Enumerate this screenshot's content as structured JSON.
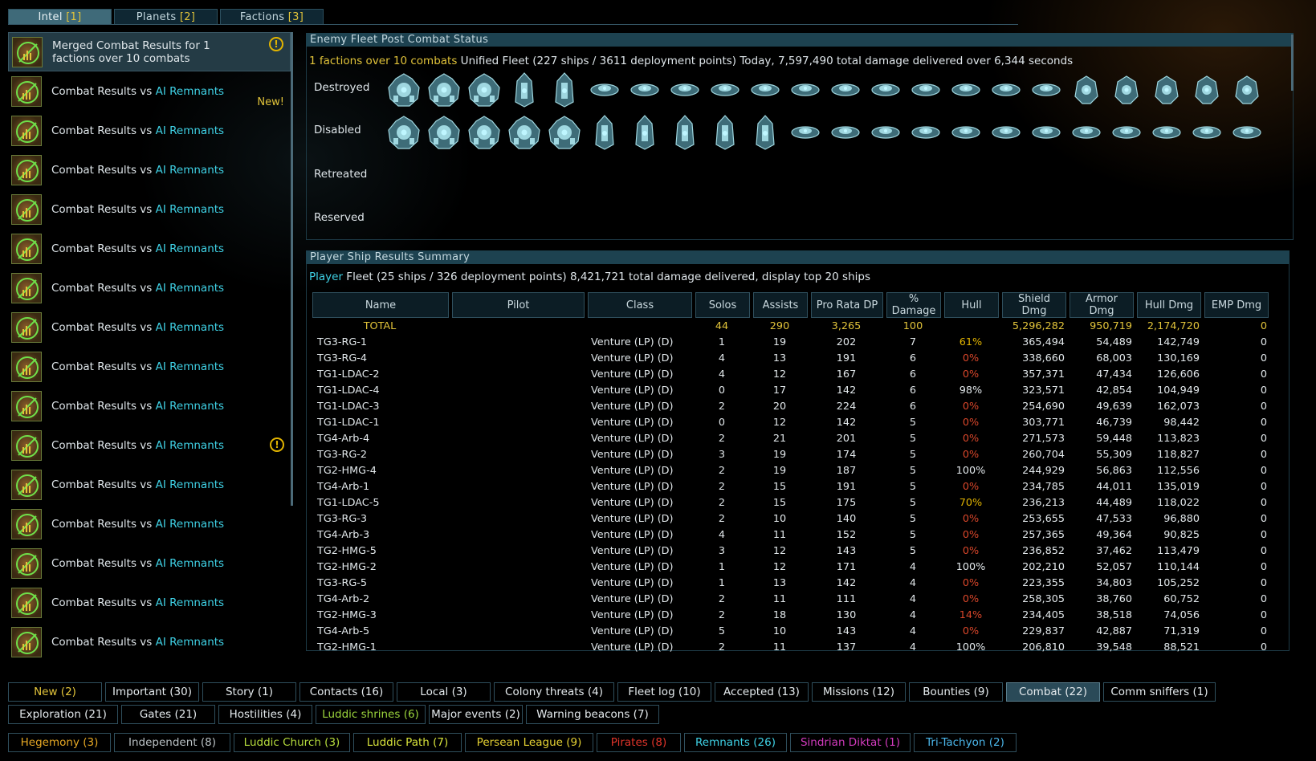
{
  "top_tabs": [
    {
      "label": "Intel",
      "count": "[1]",
      "active": true
    },
    {
      "label": "Planets",
      "count": "[2]",
      "active": false
    },
    {
      "label": "Factions",
      "count": "[3]",
      "active": false
    }
  ],
  "intel_list": {
    "merged": {
      "title": "Merged Combat Results for 1 factions over 10 combats"
    },
    "item_prefix": "Combat Results vs ",
    "item_faction": "AI Remnants",
    "new_label": "New!",
    "warn_glyph": "!",
    "item_count": 15
  },
  "enemy_panel": {
    "title": "Enemy Fleet Post Combat Status",
    "summary_highlight": "1 factions over 10 combats",
    "summary_rest": " Unified Fleet (227 ships / 3611 deployment points) Today, 7,597,490 total damage delivered over 6,344 seconds",
    "rows": [
      {
        "label": "Destroyed",
        "ships": [
          "heavy",
          "heavy",
          "heavy",
          "tower",
          "tower",
          "disc",
          "disc",
          "disc",
          "disc",
          "disc",
          "disc",
          "disc",
          "disc",
          "disc",
          "disc",
          "disc",
          "disc",
          "claw",
          "claw",
          "claw",
          "claw",
          "claw"
        ]
      },
      {
        "label": "Disabled",
        "ships": [
          "heavy",
          "heavy",
          "heavy",
          "heavy",
          "heavy",
          "tower",
          "tower",
          "tower",
          "tower",
          "tower",
          "disc",
          "disc",
          "disc",
          "disc",
          "disc",
          "disc",
          "disc",
          "disc",
          "disc",
          "disc",
          "disc",
          "disc"
        ]
      },
      {
        "label": "Retreated",
        "ships": []
      },
      {
        "label": "Reserved",
        "ships": []
      }
    ]
  },
  "player_panel": {
    "title": "Player Ship Results Summary",
    "summary_highlight": "Player",
    "summary_rest": " Fleet (25 ships / 326 deployment points) 8,421,721 total damage delivered, display top 20 ships",
    "columns": [
      "Name",
      "Pilot",
      "Class",
      "Solos",
      "Assists",
      "Pro Rata DP",
      "% Damage",
      "Hull",
      "Shield Dmg",
      "Armor Dmg",
      "Hull Dmg",
      "EMP Dmg"
    ],
    "total": {
      "name": "TOTAL",
      "solos": "44",
      "assists": "290",
      "dp": "3,265",
      "dmg": "100",
      "hull": "",
      "shield": "5,296,282",
      "armor": "950,719",
      "hulldmg": "2,174,720",
      "emp": "0"
    },
    "rows": [
      {
        "name": "TG3-RG-1",
        "cls": "Venture (LP) (D)",
        "solos": "1",
        "assists": "19",
        "dp": "202",
        "dmg": "7",
        "hull": "61%",
        "hc": "yel",
        "shield": "365,494",
        "armor": "54,489",
        "hulldmg": "142,749",
        "emp": "0"
      },
      {
        "name": "TG3-RG-4",
        "cls": "Venture (LP) (D)",
        "solos": "4",
        "assists": "13",
        "dp": "191",
        "dmg": "6",
        "hull": "0%",
        "hc": "red",
        "shield": "338,660",
        "armor": "68,003",
        "hulldmg": "130,169",
        "emp": "0"
      },
      {
        "name": "TG1-LDAC-2",
        "cls": "Venture (LP) (D)",
        "solos": "4",
        "assists": "12",
        "dp": "167",
        "dmg": "6",
        "hull": "0%",
        "hc": "red",
        "shield": "357,371",
        "armor": "47,434",
        "hulldmg": "126,606",
        "emp": "0"
      },
      {
        "name": "TG1-LDAC-4",
        "cls": "Venture (LP) (D)",
        "solos": "0",
        "assists": "17",
        "dp": "142",
        "dmg": "6",
        "hull": "98%",
        "hc": "",
        "shield": "323,571",
        "armor": "42,854",
        "hulldmg": "104,949",
        "emp": "0"
      },
      {
        "name": "TG1-LDAC-3",
        "cls": "Venture (LP) (D)",
        "solos": "2",
        "assists": "20",
        "dp": "224",
        "dmg": "6",
        "hull": "0%",
        "hc": "red",
        "shield": "254,690",
        "armor": "49,639",
        "hulldmg": "162,073",
        "emp": "0"
      },
      {
        "name": "TG1-LDAC-1",
        "cls": "Venture (LP) (D)",
        "solos": "0",
        "assists": "12",
        "dp": "142",
        "dmg": "5",
        "hull": "0%",
        "hc": "red",
        "shield": "303,771",
        "armor": "46,739",
        "hulldmg": "98,442",
        "emp": "0"
      },
      {
        "name": "TG4-Arb-4",
        "cls": "Venture (LP) (D)",
        "solos": "2",
        "assists": "21",
        "dp": "201",
        "dmg": "5",
        "hull": "0%",
        "hc": "red",
        "shield": "271,573",
        "armor": "59,448",
        "hulldmg": "113,823",
        "emp": "0"
      },
      {
        "name": "TG3-RG-2",
        "cls": "Venture (LP) (D)",
        "solos": "3",
        "assists": "19",
        "dp": "174",
        "dmg": "5",
        "hull": "0%",
        "hc": "red",
        "shield": "260,704",
        "armor": "55,309",
        "hulldmg": "118,827",
        "emp": "0"
      },
      {
        "name": "TG2-HMG-4",
        "cls": "Venture (LP) (D)",
        "solos": "2",
        "assists": "19",
        "dp": "187",
        "dmg": "5",
        "hull": "100%",
        "hc": "",
        "shield": "244,929",
        "armor": "56,863",
        "hulldmg": "112,556",
        "emp": "0"
      },
      {
        "name": "TG4-Arb-1",
        "cls": "Venture (LP) (D)",
        "solos": "2",
        "assists": "15",
        "dp": "191",
        "dmg": "5",
        "hull": "0%",
        "hc": "red",
        "shield": "234,785",
        "armor": "44,011",
        "hulldmg": "135,019",
        "emp": "0"
      },
      {
        "name": "TG1-LDAC-5",
        "cls": "Venture (LP) (D)",
        "solos": "2",
        "assists": "15",
        "dp": "175",
        "dmg": "5",
        "hull": "70%",
        "hc": "yel",
        "shield": "236,213",
        "armor": "44,489",
        "hulldmg": "118,022",
        "emp": "0"
      },
      {
        "name": "TG3-RG-3",
        "cls": "Venture (LP) (D)",
        "solos": "2",
        "assists": "10",
        "dp": "140",
        "dmg": "5",
        "hull": "0%",
        "hc": "red",
        "shield": "253,655",
        "armor": "47,533",
        "hulldmg": "96,880",
        "emp": "0"
      },
      {
        "name": "TG4-Arb-3",
        "cls": "Venture (LP) (D)",
        "solos": "4",
        "assists": "11",
        "dp": "152",
        "dmg": "5",
        "hull": "0%",
        "hc": "red",
        "shield": "257,365",
        "armor": "49,364",
        "hulldmg": "90,825",
        "emp": "0"
      },
      {
        "name": "TG2-HMG-5",
        "cls": "Venture (LP) (D)",
        "solos": "3",
        "assists": "12",
        "dp": "143",
        "dmg": "5",
        "hull": "0%",
        "hc": "red",
        "shield": "236,852",
        "armor": "37,462",
        "hulldmg": "113,479",
        "emp": "0"
      },
      {
        "name": "TG2-HMG-2",
        "cls": "Venture (LP) (D)",
        "solos": "1",
        "assists": "12",
        "dp": "171",
        "dmg": "4",
        "hull": "100%",
        "hc": "",
        "shield": "202,210",
        "armor": "52,057",
        "hulldmg": "110,144",
        "emp": "0"
      },
      {
        "name": "TG3-RG-5",
        "cls": "Venture (LP) (D)",
        "solos": "1",
        "assists": "13",
        "dp": "142",
        "dmg": "4",
        "hull": "0%",
        "hc": "red",
        "shield": "223,355",
        "armor": "34,803",
        "hulldmg": "105,252",
        "emp": "0"
      },
      {
        "name": "TG4-Arb-2",
        "cls": "Venture (LP) (D)",
        "solos": "2",
        "assists": "11",
        "dp": "111",
        "dmg": "4",
        "hull": "0%",
        "hc": "red",
        "shield": "258,305",
        "armor": "38,760",
        "hulldmg": "60,752",
        "emp": "0"
      },
      {
        "name": "TG2-HMG-3",
        "cls": "Venture (LP) (D)",
        "solos": "2",
        "assists": "18",
        "dp": "130",
        "dmg": "4",
        "hull": "14%",
        "hc": "red",
        "shield": "234,405",
        "armor": "38,518",
        "hulldmg": "74,056",
        "emp": "0"
      },
      {
        "name": "TG4-Arb-5",
        "cls": "Venture (LP) (D)",
        "solos": "5",
        "assists": "10",
        "dp": "143",
        "dmg": "4",
        "hull": "0%",
        "hc": "red",
        "shield": "229,837",
        "armor": "42,887",
        "hulldmg": "71,319",
        "emp": "0"
      },
      {
        "name": "TG2-HMG-1",
        "cls": "Venture (LP) (D)",
        "solos": "2",
        "assists": "11",
        "dp": "137",
        "dmg": "4",
        "hull": "100%",
        "hc": "",
        "shield": "206,810",
        "armor": "39,548",
        "hulldmg": "88,521",
        "emp": "0"
      }
    ]
  },
  "filters": {
    "row1": [
      {
        "label": "New (2)",
        "color": "#e2c43a",
        "w": 117
      },
      {
        "label": "Important (30)",
        "color": "#e4eaed",
        "w": 117
      },
      {
        "label": "Story (1)",
        "color": "#e4eaed",
        "w": 117
      },
      {
        "label": "Contacts (16)",
        "color": "#e4eaed",
        "w": 117
      },
      {
        "label": "Local (3)",
        "color": "#e4eaed",
        "w": 117
      },
      {
        "label": "Colony threats (4)",
        "color": "#e4eaed",
        "w": 150
      },
      {
        "label": "Fleet log (10)",
        "color": "#e4eaed",
        "w": 117
      },
      {
        "label": "Accepted (13)",
        "color": "#e4eaed",
        "w": 117
      },
      {
        "label": "Missions (12)",
        "color": "#e4eaed",
        "w": 117
      },
      {
        "label": "Bounties (9)",
        "color": "#e4eaed",
        "w": 117
      },
      {
        "label": "Combat (22)",
        "color": "#e4eaed",
        "w": 117,
        "active": true
      },
      {
        "label": "Comm sniffers (1)",
        "color": "#e4eaed",
        "w": 140
      }
    ],
    "row2": [
      {
        "label": "Exploration (21)",
        "color": "#e4eaed",
        "w": 137
      },
      {
        "label": "Gates (21)",
        "color": "#e4eaed",
        "w": 117
      },
      {
        "label": "Hostilities (4)",
        "color": "#e4eaed",
        "w": 117
      },
      {
        "label": "Luddic shrines (6)",
        "color": "#9bd43c",
        "w": 137
      },
      {
        "label": "Major events (2)",
        "color": "#e4eaed",
        "w": 117
      },
      {
        "label": "Warning beacons (7)",
        "color": "#e4eaed",
        "w": 166
      }
    ],
    "row3": [
      {
        "label": "Hegemony (3)",
        "color": "#e6a824",
        "w": 128
      },
      {
        "label": "Independent (8)",
        "color": "#b9c0c3",
        "w": 145
      },
      {
        "label": "Luddic Church (3)",
        "color": "#b5db3c",
        "w": 145
      },
      {
        "label": "Luddic Path (7)",
        "color": "#d7e23b",
        "w": 135
      },
      {
        "label": "Persean League (9)",
        "color": "#e6d233",
        "w": 160
      },
      {
        "label": "Pirates (8)",
        "color": "#e0342a",
        "w": 105
      },
      {
        "label": "Remnants (26)",
        "color": "#3fd2e6",
        "w": 128
      },
      {
        "label": "Sindrian Diktat (1)",
        "color": "#d23bbd",
        "w": 150
      },
      {
        "label": "Tri-Tachyon (2)",
        "color": "#4bb6ea",
        "w": 128
      }
    ]
  }
}
